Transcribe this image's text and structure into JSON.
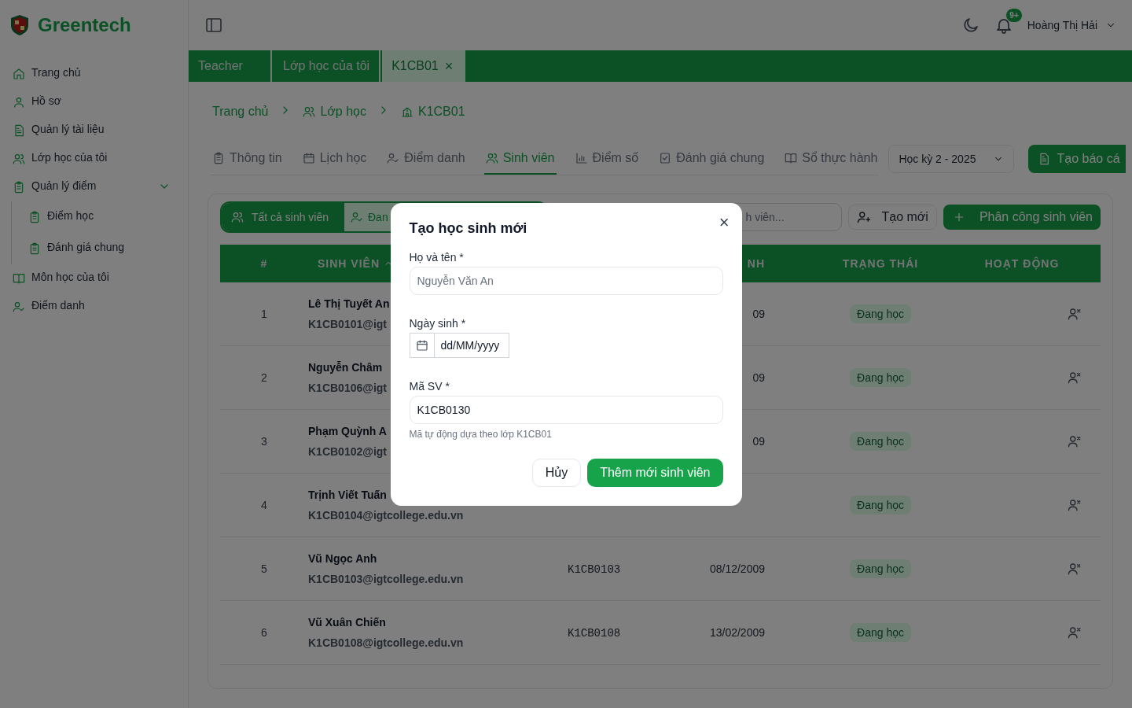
{
  "sidebar": {
    "brand": "Greentech",
    "items": [
      {
        "label": "Trang chủ"
      },
      {
        "label": "Hồ sơ"
      },
      {
        "label": "Quản lý tài liệu"
      },
      {
        "label": "Lớp học của tôi"
      },
      {
        "label": "Quản lý điểm",
        "expanded": true,
        "children": [
          {
            "label": "Điểm học"
          },
          {
            "label": "Đánh giá chung"
          }
        ]
      },
      {
        "label": "Môn học của tôi"
      },
      {
        "label": "Điểm danh"
      }
    ]
  },
  "topbar": {
    "notification_badge": "9+",
    "user_name": "Hoàng Thị Hải"
  },
  "tabs": [
    {
      "label": "Teacher",
      "selected": false
    },
    {
      "label": "Lớp học của tôi",
      "selected": false
    },
    {
      "label": "K1CB01",
      "selected": true,
      "close": "×"
    }
  ],
  "breadcrumb": [
    "Trang chủ",
    "Lớp học",
    "K1CB01"
  ],
  "section_tabs": [
    {
      "label": "Thông tin",
      "selected": false
    },
    {
      "label": "Lịch học",
      "selected": false
    },
    {
      "label": "Điểm danh",
      "selected": false
    },
    {
      "label": "Sinh viên",
      "selected": true
    },
    {
      "label": "Điểm số",
      "selected": false
    },
    {
      "label": "Đánh giá chung",
      "selected": false
    },
    {
      "label": "Sổ thực hành",
      "selected": false
    }
  ],
  "semester_select": {
    "value": "Học kỳ 2 - 2025"
  },
  "report_button": "Tạo báo cá",
  "filters": [
    {
      "label": "Tất cả sinh viên",
      "selected": true
    },
    {
      "label": "Đan",
      "selected": false
    }
  ],
  "search": {
    "placeholder": "h viên..."
  },
  "create_button": "Tạo mới",
  "assign_button": "Phân công sinh viên",
  "table": {
    "columns": {
      "column_1": "#",
      "column_2": "SINH VIÊN",
      "column_4": "NH",
      "column_5": "TRẠNG THÁI",
      "column_6": "HOẠT ĐỘNG"
    },
    "rows": [
      {
        "index": "1",
        "name": "Lê Thị Tuyết An",
        "email": "K1CB0101@igt",
        "date": "09",
        "status": "Đang học"
      },
      {
        "index": "2",
        "name": "Nguyễn Châm",
        "email": "K1CB0106@igt",
        "date": "09",
        "status": "Đang học"
      },
      {
        "index": "3",
        "name": "Phạm Quỳnh A",
        "email": "K1CB0102@igt",
        "date": "09",
        "status": "Đang học"
      },
      {
        "index": "4",
        "name": "Trịnh Viết Tuấn",
        "email": "K1CB0104@igtcollege.edu.vn",
        "status": "Đang học"
      },
      {
        "index": "5",
        "name": "Vũ Ngọc Anh",
        "email": "K1CB0103@igtcollege.edu.vn",
        "code": "K1CB0103",
        "date": "08/12/2009",
        "status": "Đang học"
      },
      {
        "index": "6",
        "name": "Vũ Xuân Chiến",
        "email": "K1CB0108@igtcollege.edu.vn",
        "code": "K1CB0108",
        "date": "13/02/2009",
        "status": "Đang học"
      }
    ]
  },
  "modal": {
    "title": "Tạo học sinh mới",
    "close": "×",
    "name_label": "Họ và tên *",
    "name_placeholder": "Nguyễn Văn An",
    "dob_label": "Ngày sinh *",
    "dob_value": "dd/MM/yyyy",
    "code_label": "Mã SV *",
    "code_value": "K1CB0130",
    "code_hint": "Mã tự động dựa theo lớp K1CB01",
    "cancel": "Hủy",
    "submit": "Thêm mới sinh viên"
  }
}
